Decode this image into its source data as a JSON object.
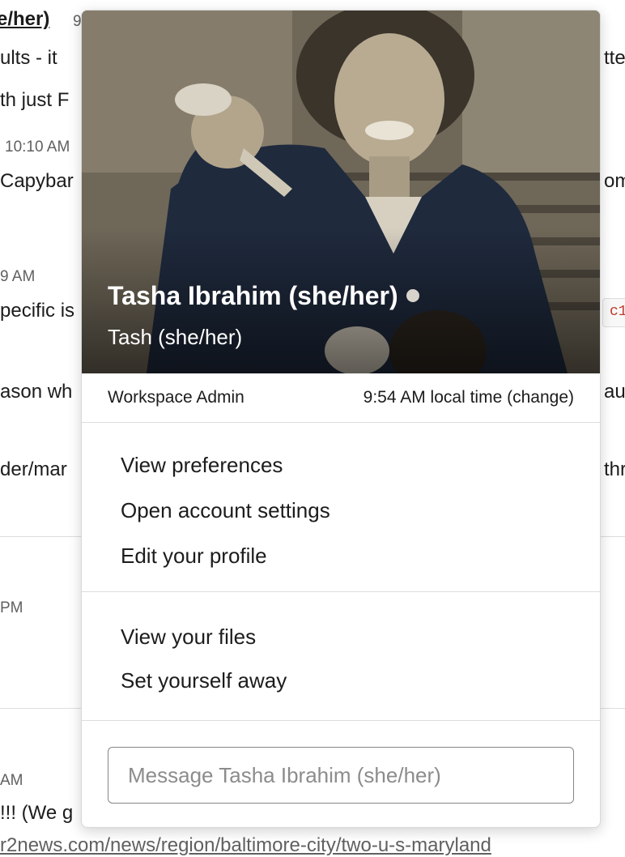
{
  "background": {
    "fragments": [
      {
        "id": "author-link",
        "text": "e/her)",
        "kind": "link"
      },
      {
        "id": "time-top",
        "text": "9",
        "kind": "time"
      },
      {
        "id": "msg-1",
        "text": "ults - it",
        "kind": "msg"
      },
      {
        "id": "msg-1-right",
        "text": "tte",
        "kind": "msg"
      },
      {
        "id": "msg-2",
        "text": "th just F",
        "kind": "msg"
      },
      {
        "id": "time-1010",
        "text": "10:10 AM",
        "kind": "time"
      },
      {
        "id": "msg-3",
        "text": "Capybar",
        "kind": "msg"
      },
      {
        "id": "msg-3-right",
        "text": "om",
        "kind": "msg"
      },
      {
        "id": "time-9am",
        "text": "9 AM",
        "kind": "time"
      },
      {
        "id": "msg-4",
        "text": "pecific is",
        "kind": "msg"
      },
      {
        "id": "msg-5",
        "text": "ason wh",
        "kind": "msg"
      },
      {
        "id": "msg-5-right",
        "text": "aus",
        "kind": "msg"
      },
      {
        "id": "msg-6",
        "text": "der/mar",
        "kind": "msg"
      },
      {
        "id": "msg-6-right",
        "text": "thr",
        "kind": "msg"
      },
      {
        "id": "time-pm",
        "text": "PM",
        "kind": "time"
      },
      {
        "id": "time-am",
        "text": "AM",
        "kind": "time"
      },
      {
        "id": "msg-7",
        "text": "!!! (We g",
        "kind": "msg"
      },
      {
        "id": "msg-8-url",
        "text": "r2news.com/news/region/baltimore-city/two-u-s-maryland",
        "kind": "url"
      }
    ],
    "code_snippet": "c1"
  },
  "profile": {
    "full_name": "Tasha Ibrahim (she/her)",
    "display_name": "Tash (she/her)",
    "role": "Workspace Admin",
    "local_time": "9:54 AM local time",
    "change_link": "(change)",
    "presence": "away",
    "presence_color": "#d8d4cc"
  },
  "menu": {
    "section_1": [
      "View preferences",
      "Open account settings",
      "Edit your profile"
    ],
    "section_2": [
      "View your files",
      "Set yourself away"
    ]
  },
  "message": {
    "placeholder": "Message Tasha Ibrahim (she/her)",
    "value": ""
  }
}
